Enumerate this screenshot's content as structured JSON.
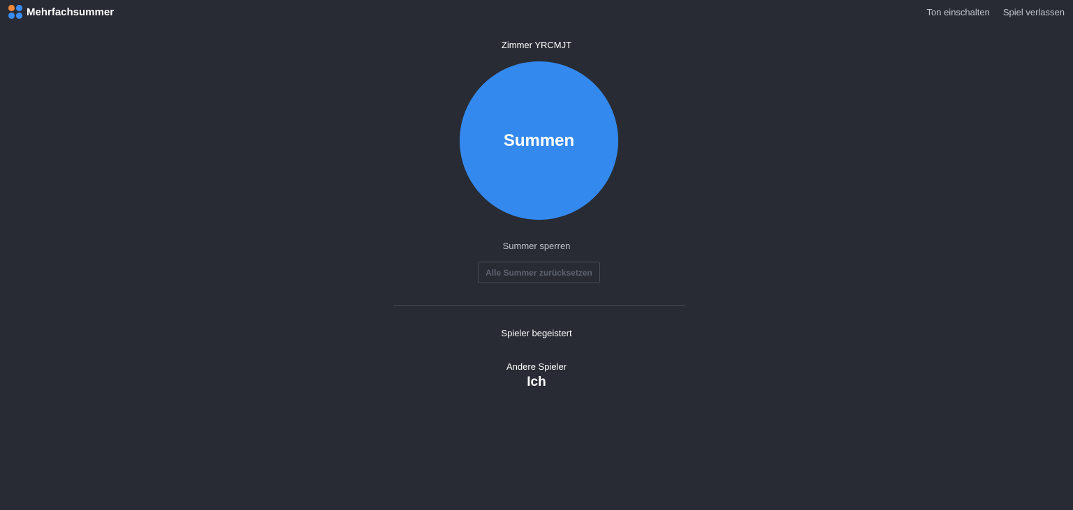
{
  "header": {
    "brand_name": "Mehrfachsummer",
    "logo_colors": [
      "#f0883a",
      "#3a8cf0",
      "#3a8cf0",
      "#3a8cf0"
    ],
    "nav": {
      "sound_on": "Ton einschalten",
      "leave_game": "Spiel verlassen"
    }
  },
  "main": {
    "room_label": "Zimmer YRCMJT",
    "buzzer_label": "Summen",
    "buzzer_color": "#3389ee",
    "lock_label": "Summer sperren",
    "reset_label": "Alle Summer zurücksetzen",
    "players_status": "Spieler begeistert",
    "other_players_label": "Andere Spieler",
    "self_player": "Ich"
  },
  "colors": {
    "background": "#282b33",
    "text": "#ffffff",
    "muted_text": "#c3c6cd",
    "disabled_text": "#5e6370"
  }
}
